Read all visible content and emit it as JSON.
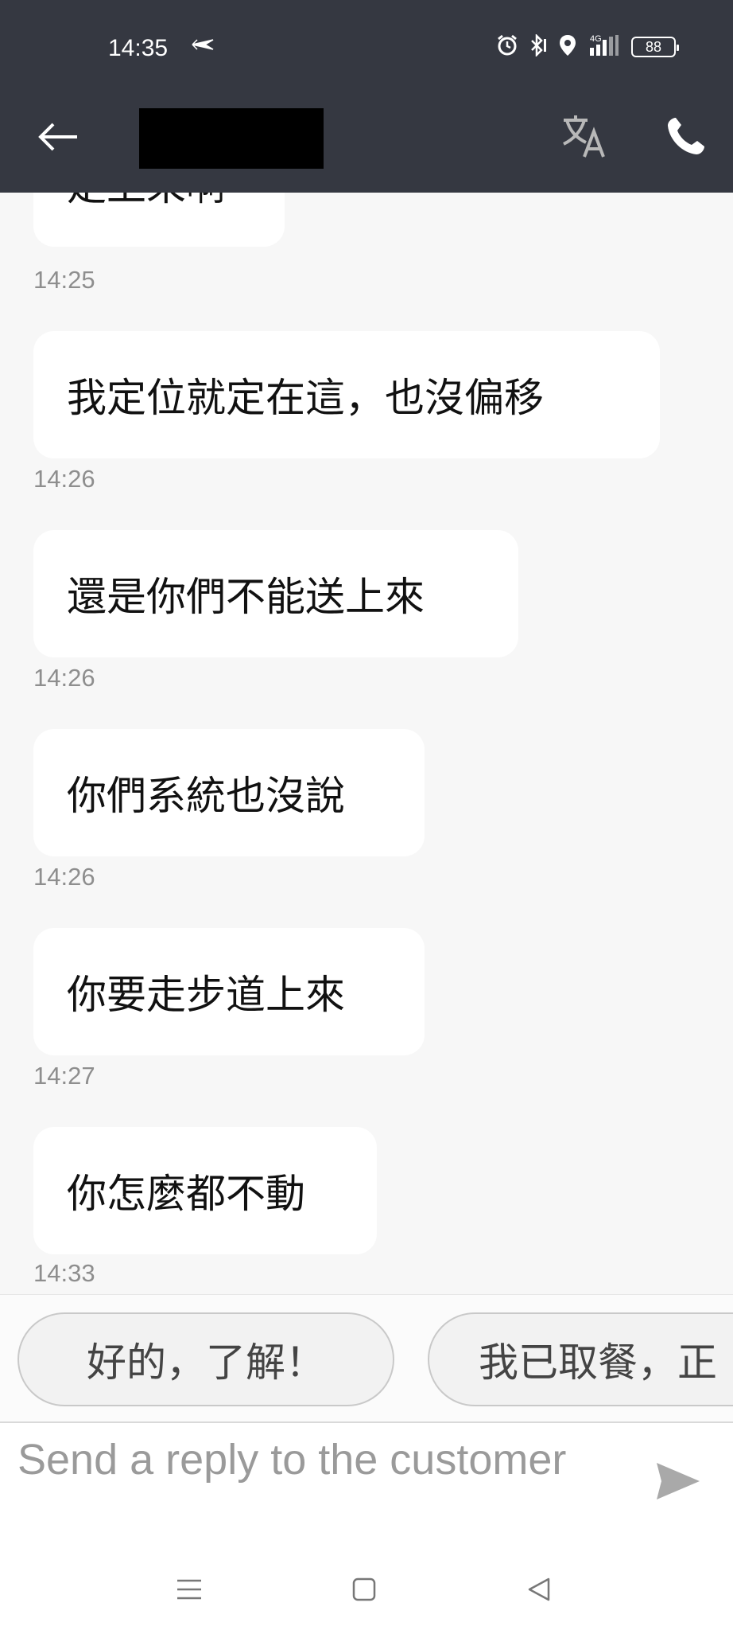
{
  "status_bar": {
    "time": "14:35",
    "battery": "88",
    "network": "4G"
  },
  "header": {
    "back_icon": "arrow-left-icon",
    "translate_icon": "translate-icon",
    "call_icon": "phone-icon"
  },
  "messages": [
    {
      "text": "走上來啊",
      "time": "14:25"
    },
    {
      "text": "我定位就定在這，也沒偏移",
      "time": "14:26"
    },
    {
      "text": "還是你們不能送上來",
      "time": "14:26"
    },
    {
      "text": "你們系統也沒說",
      "time": "14:26"
    },
    {
      "text": "你要走步道上來",
      "time": "14:27"
    },
    {
      "text": "你怎麼都不動",
      "time": "14:33"
    }
  ],
  "quick_replies": [
    "好的，了解！",
    "我已取餐，正"
  ],
  "composer": {
    "placeholder": "Send a reply to the customer",
    "send_icon": "send-icon"
  },
  "colors": {
    "header_bg": "#353841",
    "chat_bg": "#f7f7f7",
    "bubble_bg": "#ffffff"
  }
}
